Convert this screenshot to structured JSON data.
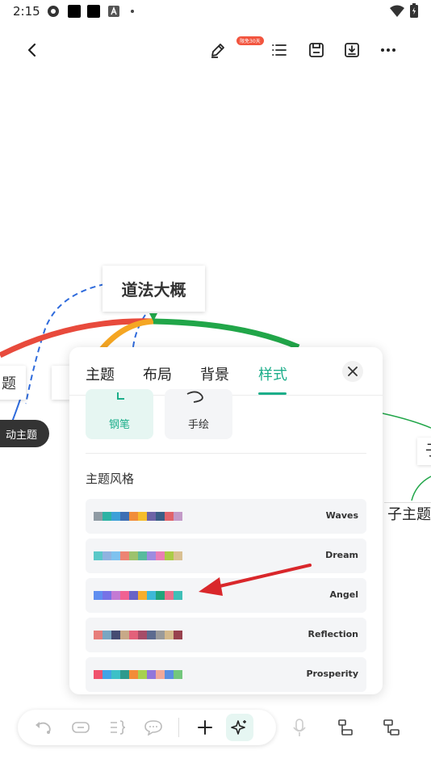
{
  "status_bar": {
    "time": "2:15"
  },
  "toolbar": {
    "badge": "限免30天"
  },
  "mindmap": {
    "central": "道法大概",
    "left_topic": "题",
    "left_sub": "动主题",
    "right_sub1": "子主题",
    "right_sub2": "子"
  },
  "panel": {
    "tabs": [
      {
        "label": "主题"
      },
      {
        "label": "布局"
      },
      {
        "label": "背景"
      },
      {
        "label": "样式"
      }
    ],
    "style_options": [
      {
        "label": "钢笔"
      },
      {
        "label": "手绘"
      }
    ],
    "section_title": "主题风格",
    "themes": [
      {
        "name": "Waves",
        "colors": [
          "#8f9ba4",
          "#2db3a4",
          "#3da0d8",
          "#3e6fb4",
          "#f18d3a",
          "#f6bd2c",
          "#6d64a6",
          "#3a5e86",
          "#e1636a",
          "#c39ac8"
        ]
      },
      {
        "name": "Dream",
        "colors": [
          "#5ac8c8",
          "#8fb3e0",
          "#7ec2ef",
          "#ed8473",
          "#9dc26d",
          "#59bb9e",
          "#9d8ce0",
          "#ea7eb5",
          "#aacc47",
          "#d9c092"
        ]
      },
      {
        "name": "Angel",
        "colors": [
          "#5f8ef0",
          "#7772e6",
          "#c37ad4",
          "#f06292",
          "#6a63c6",
          "#f6ae2d",
          "#3eb8d6",
          "#21a47a",
          "#ea6f8a",
          "#3fbfb7"
        ]
      },
      {
        "name": "Reflection",
        "colors": [
          "#e77e7b",
          "#7aa6c2",
          "#454b72",
          "#c8a987",
          "#e3617a",
          "#a64d68",
          "#5c6b8f",
          "#9a9a9a",
          "#d4b98b",
          "#98414e"
        ]
      },
      {
        "name": "Prosperity",
        "colors": [
          "#f0526d",
          "#42a4e6",
          "#3dc1c7",
          "#2c9a8d",
          "#f28c38",
          "#a7d04f",
          "#9176db",
          "#f2a898",
          "#5b8fe0",
          "#73c77c"
        ]
      }
    ]
  },
  "colors": {
    "accent": "#1cae8a",
    "arrow": "#d9272b"
  }
}
